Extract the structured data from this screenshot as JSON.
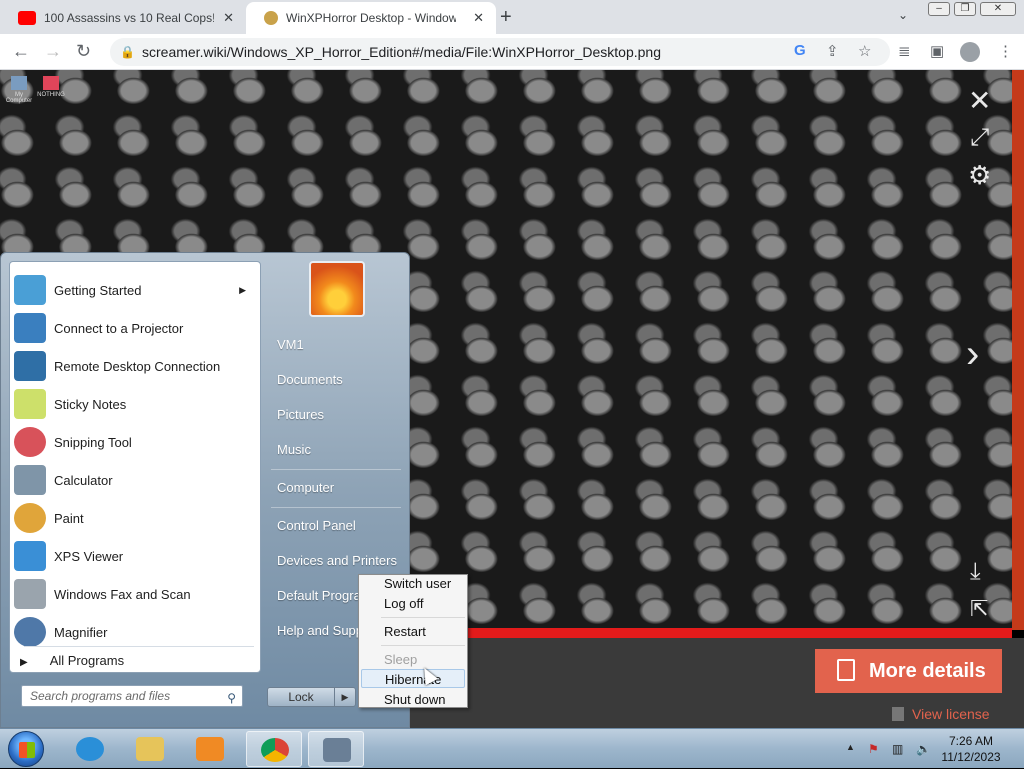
{
  "browser": {
    "tabs": [
      {
        "title": "100 Assassins vs 10 Real Cops! -",
        "favicon": "youtube-icon",
        "favicon_color": "#ff0000",
        "active": false
      },
      {
        "title": "WinXPHorror Desktop - Window",
        "favicon": "wiki-icon",
        "favicon_color": "#c9a24a",
        "active": true
      }
    ],
    "url": "screamer.wiki/Windows_XP_Horror_Edition#/media/File:WinXPHorror_Desktop.png"
  },
  "lightbox": {
    "more_details_label": "More details",
    "view_license_label": "View license",
    "accent": "#e2634d"
  },
  "desktop_icons": [
    {
      "label": "My Computer"
    },
    {
      "label": "NOTHING"
    }
  ],
  "start_menu": {
    "programs": [
      {
        "label": "Getting Started",
        "icon": "getting-started-icon",
        "color": "#4a9fd6",
        "has_submenu": true
      },
      {
        "label": "Connect to a Projector",
        "icon": "projector-icon",
        "color": "#3a7fbf",
        "has_submenu": false
      },
      {
        "label": "Remote Desktop Connection",
        "icon": "remote-desktop-icon",
        "color": "#2f6fa6",
        "has_submenu": false
      },
      {
        "label": "Sticky Notes",
        "icon": "sticky-notes-icon",
        "color": "#cde06a",
        "has_submenu": false
      },
      {
        "label": "Snipping Tool",
        "icon": "snipping-tool-icon",
        "color": "#d8525a",
        "has_submenu": false
      },
      {
        "label": "Calculator",
        "icon": "calculator-icon",
        "color": "#7f95a8",
        "has_submenu": false
      },
      {
        "label": "Paint",
        "icon": "paint-icon",
        "color": "#e0a53a",
        "has_submenu": false
      },
      {
        "label": "XPS Viewer",
        "icon": "xps-viewer-icon",
        "color": "#3a8fd6",
        "has_submenu": false
      },
      {
        "label": "Windows Fax and Scan",
        "icon": "fax-scan-icon",
        "color": "#9aa4ad",
        "has_submenu": false
      },
      {
        "label": "Magnifier",
        "icon": "magnifier-icon",
        "color": "#4f78a8",
        "has_submenu": false
      }
    ],
    "all_programs_label": "All Programs",
    "search_placeholder": "Search programs and files",
    "right_links": [
      {
        "label": "VM1"
      },
      {
        "label": "Documents"
      },
      {
        "label": "Pictures"
      },
      {
        "label": "Music"
      },
      {
        "label": "Computer"
      },
      {
        "label": "Control Panel"
      },
      {
        "label": "Devices and Printers"
      },
      {
        "label": "Default Programs"
      },
      {
        "label": "Help and Support"
      }
    ],
    "lock_label": "Lock",
    "power_submenu": [
      {
        "label": "Switch user",
        "enabled": true,
        "highlighted": false
      },
      {
        "label": "Log off",
        "enabled": true,
        "highlighted": false
      },
      {
        "label": "Restart",
        "enabled": true,
        "highlighted": false
      },
      {
        "label": "Sleep",
        "enabled": false,
        "highlighted": false
      },
      {
        "label": "Hibernate",
        "enabled": true,
        "highlighted": true
      },
      {
        "label": "Shut down",
        "enabled": true,
        "highlighted": false
      }
    ]
  },
  "taskbar": {
    "pinned": [
      {
        "name": "internet-explorer-icon",
        "color": "#2a8fd8"
      },
      {
        "name": "file-explorer-icon",
        "color": "#e6c45a"
      },
      {
        "name": "media-player-icon",
        "color": "#f08a24"
      },
      {
        "name": "chrome-icon",
        "color": "#db4437"
      },
      {
        "name": "keyboard-app-icon",
        "color": "#6a7f96"
      }
    ],
    "clock_time": "7:26 AM",
    "clock_date": "11/12/2023"
  }
}
